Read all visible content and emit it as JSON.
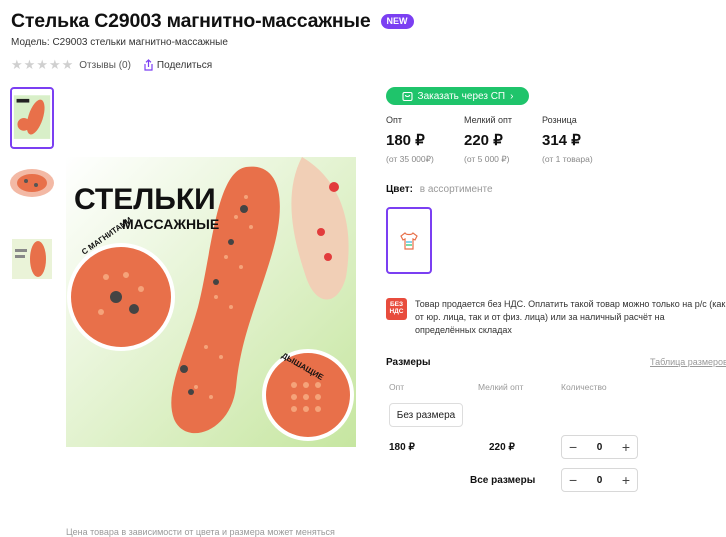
{
  "product": {
    "title": "Стелька C29003 магнитно-массажные",
    "badge": "NEW",
    "model": "Модель: C29003 стельки магнитно-массажные",
    "reviews": "Отзывы (0)",
    "share": "Поделиться"
  },
  "image": {
    "headline_1": "СТЕЛЬКИ",
    "headline_2": "МАССАЖНЫЕ",
    "badge_magnets": "С МАГНИТАМИ",
    "badge_breathing": "ДЫШАЩИЕ",
    "caption": "Цена товара в зависимости от цвета и размера может меняться"
  },
  "order": {
    "button_label": "Заказать через СП"
  },
  "prices": [
    {
      "label": "Опт",
      "value": "180 ₽",
      "note": "(от 35 000₽)"
    },
    {
      "label": "Мелкий опт",
      "value": "220 ₽",
      "note": "(от 5 000 ₽)"
    },
    {
      "label": "Розница",
      "value": "314 ₽",
      "note": "(от 1 товара)"
    }
  ],
  "color": {
    "label": "Цвет:",
    "value": "в ассортименте"
  },
  "vat": {
    "icon_text": "БЕЗ НДС",
    "text": "Товар продается без НДС. Оплатить такой товар можно только на р/с (как от юр. лица, так и от физ. лица) или за наличный расчёт на определённых складах"
  },
  "sizes": {
    "title": "Размеры",
    "table_link": "Таблица размеров",
    "columns": [
      "Опт",
      "Мелкий опт",
      "Количество"
    ],
    "rows": [
      {
        "size": "Без размера",
        "opt": "180 ₽",
        "small_opt": "220 ₽",
        "qty": "0"
      }
    ],
    "all_sizes_label": "Все размеры",
    "all_sizes_qty": "0"
  },
  "colors": {
    "accent": "#7b3ff2",
    "order_green": "#1fc46b",
    "insole_orange": "#e8704a",
    "vat_red": "#e84c3d"
  },
  "icons": {
    "stars": "star-icon",
    "share": "share-icon",
    "cart": "cart-icon",
    "chevron": "chevron-right-icon",
    "tshirt": "tshirt-icon",
    "minus": "minus-icon",
    "plus": "plus-icon"
  }
}
